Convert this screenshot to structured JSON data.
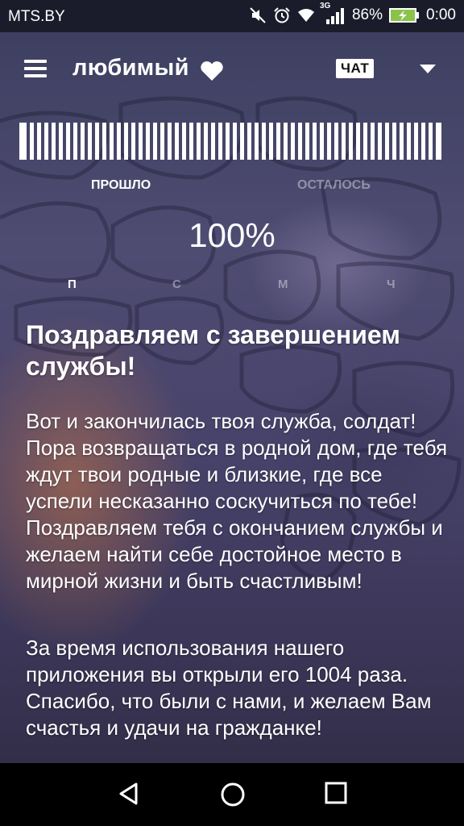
{
  "status_bar": {
    "carrier": "MTS.BY",
    "network_type": "3G",
    "battery_percent": "86%",
    "time": "0:00",
    "icons": [
      "mute-icon",
      "alarm-icon",
      "wifi-icon",
      "signal-icon",
      "battery-charging-icon"
    ]
  },
  "app_bar": {
    "title": "любимый",
    "title_icon": "heart-icon",
    "chat_label": "ЧАТ",
    "menu_icon": "hamburger-menu-icon",
    "dropdown_icon": "dropdown-triangle-icon"
  },
  "progress": {
    "passed_label": "ПРОШЛО",
    "remaining_label": "ОСТАЛОСЬ",
    "percent_text": "100%",
    "fraction": 1.0,
    "selected": "passed"
  },
  "units": {
    "d": "П",
    "h": "С",
    "m": "М",
    "s": "Ч",
    "selected": "d"
  },
  "content": {
    "title": "Поздравляем с завершением службы!",
    "paragraph_1": "Вот и закончилась твоя служба, солдат! Пора возвращаться в родной дом, где тебя ждут твои родные и близкие, где все успели несказанно соскучиться по тебе! Поздравляем тебя с окончанием службы и желаем найти себе достойное место в мирной жизни и быть счастливым!",
    "paragraph_2": "За время использования нашего приложения вы открыли его 1004 раза. Спасибо, что были с нами, и желаем Вам счастья и удачи на гражданке!"
  },
  "nav_bar": {
    "icons": [
      "back-icon",
      "home-icon",
      "recents-icon"
    ]
  },
  "colors": {
    "background_top": "#3b3e5e",
    "background_bottom": "#2d2a42",
    "text": "#ffffff",
    "inactive_text": "#ffffff66"
  }
}
